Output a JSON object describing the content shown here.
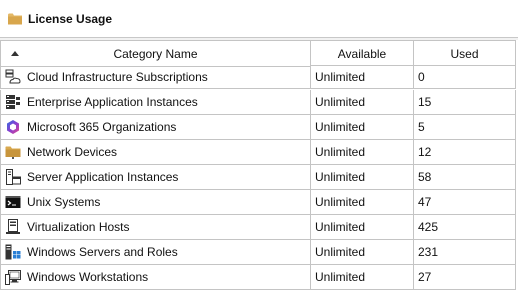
{
  "panel": {
    "title": "License Usage",
    "icon": "folder-icon"
  },
  "columns": {
    "category": "Category Name",
    "available": "Available",
    "used": "Used"
  },
  "rows": [
    {
      "icon": "cloud-server-icon",
      "name": "Cloud Infrastructure Subscriptions",
      "available": "Unlimited",
      "used": "0"
    },
    {
      "icon": "server-stack-icon",
      "name": "Enterprise Application Instances",
      "available": "Unlimited",
      "used": "15"
    },
    {
      "icon": "microsoft-365-icon",
      "name": "Microsoft 365 Organizations",
      "available": "Unlimited",
      "used": "5"
    },
    {
      "icon": "network-folder-icon",
      "name": "Network Devices",
      "available": "Unlimited",
      "used": "12"
    },
    {
      "icon": "application-server-icon",
      "name": "Server Application Instances",
      "available": "Unlimited",
      "used": "58"
    },
    {
      "icon": "terminal-icon",
      "name": "Unix Systems",
      "available": "Unlimited",
      "used": "47"
    },
    {
      "icon": "virtual-host-icon",
      "name": "Virtualization Hosts",
      "available": "Unlimited",
      "used": "425"
    },
    {
      "icon": "windows-server-icon",
      "name": "Windows Servers and Roles",
      "available": "Unlimited",
      "used": "231"
    },
    {
      "icon": "workstation-icon",
      "name": "Windows Workstations",
      "available": "Unlimited",
      "used": "27"
    }
  ]
}
